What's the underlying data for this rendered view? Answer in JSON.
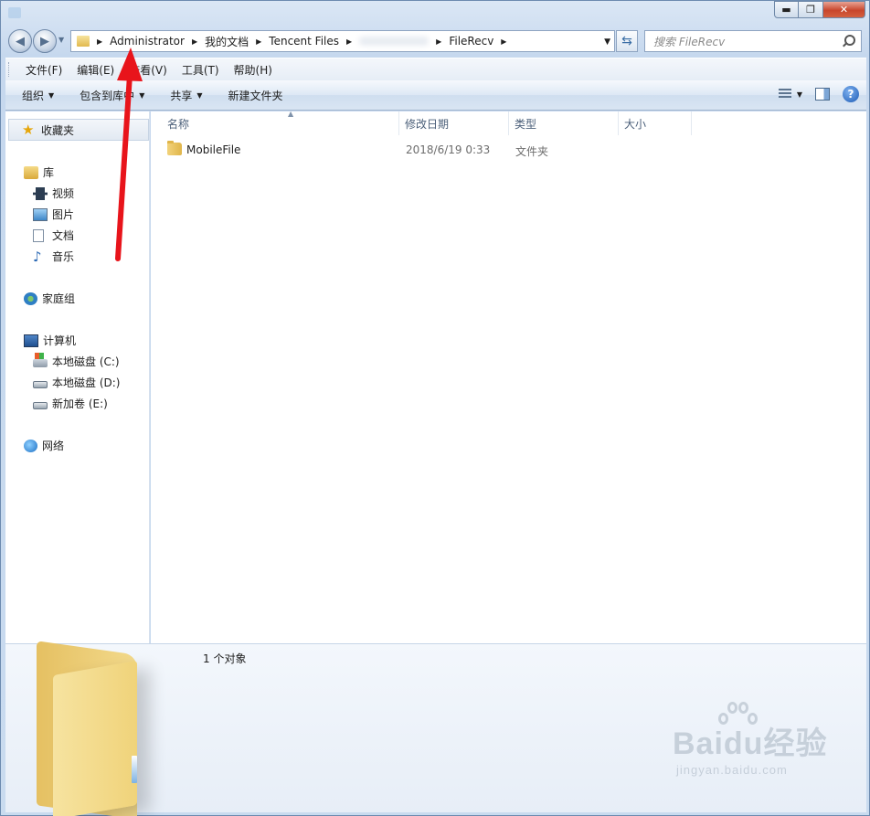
{
  "window": {
    "controls": {
      "minimize": "▬",
      "maximize": "❐",
      "close": "✕"
    }
  },
  "address_bar": {
    "crumbs": [
      "Administrator",
      "我的文档",
      "Tencent Files",
      "FileRecv"
    ],
    "search_placeholder": "搜索 FileRecv"
  },
  "menu": [
    "文件(F)",
    "编辑(E)",
    "查看(V)",
    "工具(T)",
    "帮助(H)"
  ],
  "toolbar": {
    "organize": "组织",
    "include_library": "包含到库中",
    "share": "共享",
    "new_folder": "新建文件夹"
  },
  "nav_pane": {
    "favorites": "收藏夹",
    "libraries": "库",
    "library_items": [
      "视频",
      "图片",
      "文档",
      "音乐"
    ],
    "homegroup": "家庭组",
    "computer": "计算机",
    "drives": [
      "本地磁盘 (C:)",
      "本地磁盘 (D:)",
      "新加卷 (E:)"
    ],
    "network": "网络"
  },
  "columns": {
    "name": "名称",
    "date": "修改日期",
    "type": "类型",
    "size": "大小"
  },
  "files": [
    {
      "name": "MobileFile",
      "date": "2018/6/19 0:33",
      "type": "文件夹",
      "size": ""
    }
  ],
  "details": {
    "count": "1 个对象"
  },
  "watermark": {
    "brand": "Baidu经验",
    "url": "jingyan.baidu.com"
  },
  "colors": {
    "annotation_arrow": "#e8141b",
    "accent": "#3a6ea5"
  }
}
